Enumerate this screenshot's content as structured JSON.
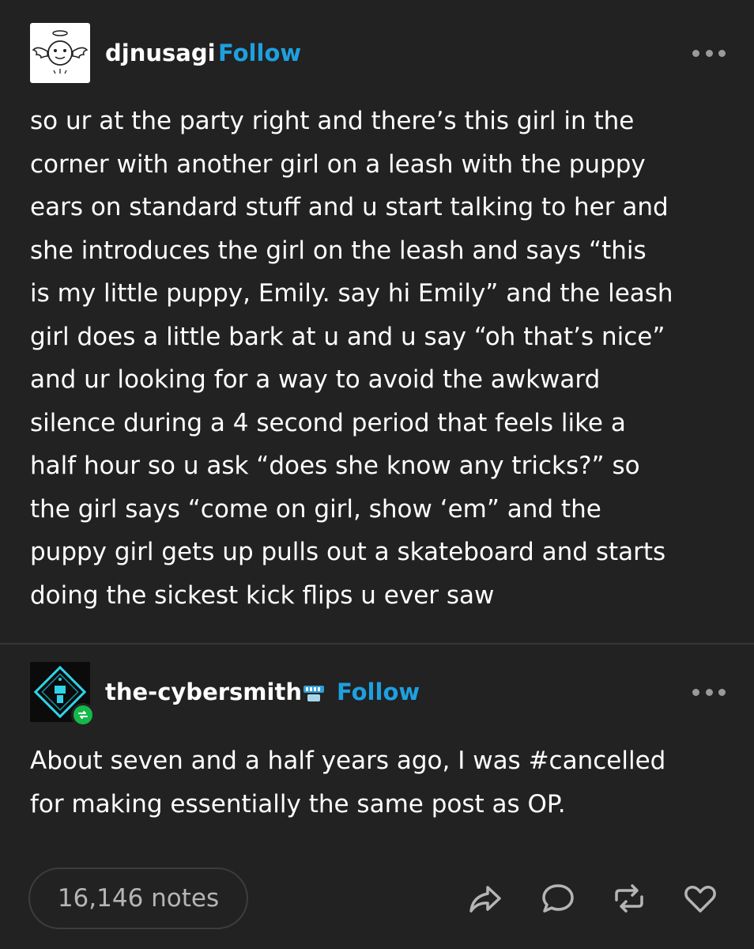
{
  "op": {
    "username": "djnusagi",
    "follow_label": "Follow",
    "body": "so ur at the party right and there’s this girl in the\ncorner with another girl on a leash with the puppy\nears on standard stuff and u start talking to her and\nshe introduces the girl on the leash and says “this\nis my little puppy, Emily. say hi Emily” and the leash\ngirl does a little bark at u and u say “oh that’s nice”\nand ur looking for a way to avoid the awkward\nsilence during a 4 second period that feels like a\nhalf hour so u ask “does she know any tricks?” so\nthe girl says “come on girl, show ‘em” and the\npuppy girl gets up pulls out a skateboard and starts\ndoing the sickest kick flips u ever saw"
  },
  "reblog": {
    "username": "the-cybersmith",
    "follow_label": "Follow",
    "body": "About seven and a half years ago, I was #cancelled\nfor making essentially the same post as OP."
  },
  "footer": {
    "notes_label": "16,146 notes",
    "actions": [
      "share-icon",
      "reply-icon",
      "reblog-icon",
      "like-icon"
    ]
  },
  "colors": {
    "background": "#222222",
    "text": "#ffffff",
    "follow": "#1ea0e0",
    "muted": "#b5b5b5",
    "reblog_badge": "#15b84a"
  }
}
